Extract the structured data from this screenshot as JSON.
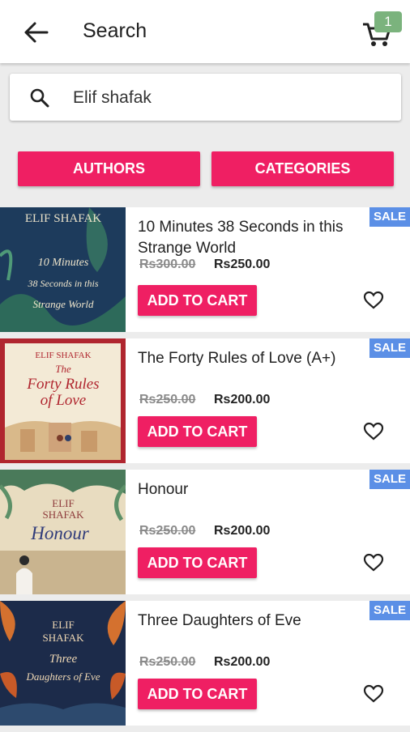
{
  "header": {
    "title": "Search",
    "cart_count": "1"
  },
  "search": {
    "value": "Elif shafak"
  },
  "filters": {
    "authors_label": "AUTHORS",
    "categories_label": "CATEGORIES"
  },
  "books": [
    {
      "title": "10 Minutes 38 Seconds in this Strange World",
      "old_price": "Rs300.00",
      "new_price": "Rs250.00",
      "button": "ADD TO CART",
      "badge": "SALE",
      "cover": {
        "author": "ELIF SHAFAK",
        "line1": "10 Minutes",
        "line2": "38 Seconds in this",
        "line3": "Strange World"
      }
    },
    {
      "title": "The Forty Rules of Love (A+)",
      "old_price": "Rs250.00",
      "new_price": "Rs200.00",
      "button": "ADD TO CART",
      "badge": "SALE",
      "cover": {
        "author": "ELIF SHAFAK",
        "line1": "The",
        "line2": "Forty Rules",
        "line3": "of Love"
      }
    },
    {
      "title": "Honour",
      "old_price": "Rs250.00",
      "new_price": "Rs200.00",
      "button": "ADD TO CART",
      "badge": "SALE",
      "cover": {
        "author": "ELIF",
        "line1": "SHAFAK",
        "line2": "Honour",
        "line3": ""
      }
    },
    {
      "title": "Three Daughters of Eve",
      "old_price": "Rs250.00",
      "new_price": "Rs200.00",
      "button": "ADD TO CART",
      "badge": "SALE",
      "cover": {
        "author": "ELIF",
        "line1": "SHAFAK",
        "line2": "Three",
        "line3": "Daughters of Eve"
      }
    }
  ]
}
